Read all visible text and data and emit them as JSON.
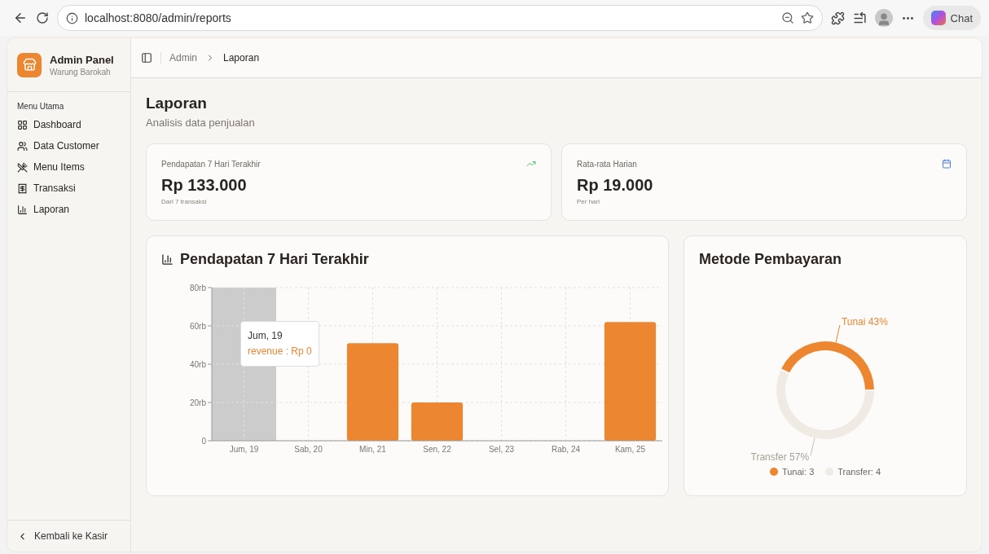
{
  "browser": {
    "url": "localhost:8080/admin/reports",
    "chat_label": "Chat"
  },
  "sidebar": {
    "title": "Admin Panel",
    "subtitle": "Warung Barokah",
    "section": "Menu Utama",
    "items": [
      {
        "label": "Dashboard"
      },
      {
        "label": "Data Customer"
      },
      {
        "label": "Menu Items"
      },
      {
        "label": "Transaksi"
      },
      {
        "label": "Laporan"
      }
    ],
    "footer_link": "Kembali ke Kasir"
  },
  "breadcrumb": [
    "Admin",
    "Laporan"
  ],
  "page": {
    "title": "Laporan",
    "subtitle": "Analisis data penjualan"
  },
  "stats": [
    {
      "label": "Pendapatan 7 Hari Terakhir",
      "value": "Rp 133.000",
      "note": "Dari 7 transaksi"
    },
    {
      "label": "Rata-rata Harian",
      "value": "Rp 19.000",
      "note": "Per hari"
    }
  ],
  "revenue_chart": {
    "title": "Pendapatan 7 Hari Terakhir",
    "bar_states": [
      {
        "hovered": true
      },
      {
        "hovered": false
      },
      {
        "hovered": false
      },
      {
        "hovered": false
      },
      {
        "hovered": false
      },
      {
        "hovered": false
      },
      {
        "hovered": false
      }
    ],
    "tooltip": {
      "title": "Jum, 19",
      "line": "revenue : Rp 0"
    },
    "chart_data": {
      "type": "bar",
      "categories": [
        "Jum, 19",
        "Sab, 20",
        "Min, 21",
        "Sen, 22",
        "Sel, 23",
        "Rab, 24",
        "Kam, 25"
      ],
      "series": [
        {
          "color": "#ed8630",
          "values": [
            0,
            0,
            51,
            20,
            0,
            0,
            62
          ]
        }
      ],
      "ylim": [
        0,
        80
      ],
      "grid": true,
      "yticks": [
        {
          "value": 0,
          "label": "0"
        },
        {
          "value": 20,
          "label": "20rb"
        },
        {
          "value": 40,
          "label": "40rb"
        },
        {
          "value": 60,
          "label": "60rb"
        },
        {
          "value": 80,
          "label": "80rb"
        }
      ]
    }
  },
  "payment_chart": {
    "title": "Metode Pembayaran",
    "chart_data": {
      "type": "donut",
      "values": [
        43,
        57
      ],
      "value_labels": [
        "Tunai 43%",
        "Transfer 57%"
      ]
    },
    "legend": [
      {
        "label": "Tunai: 3",
        "color": "#ed8630"
      },
      {
        "label": "Transfer: 4",
        "color": "#efebe4"
      }
    ]
  }
}
